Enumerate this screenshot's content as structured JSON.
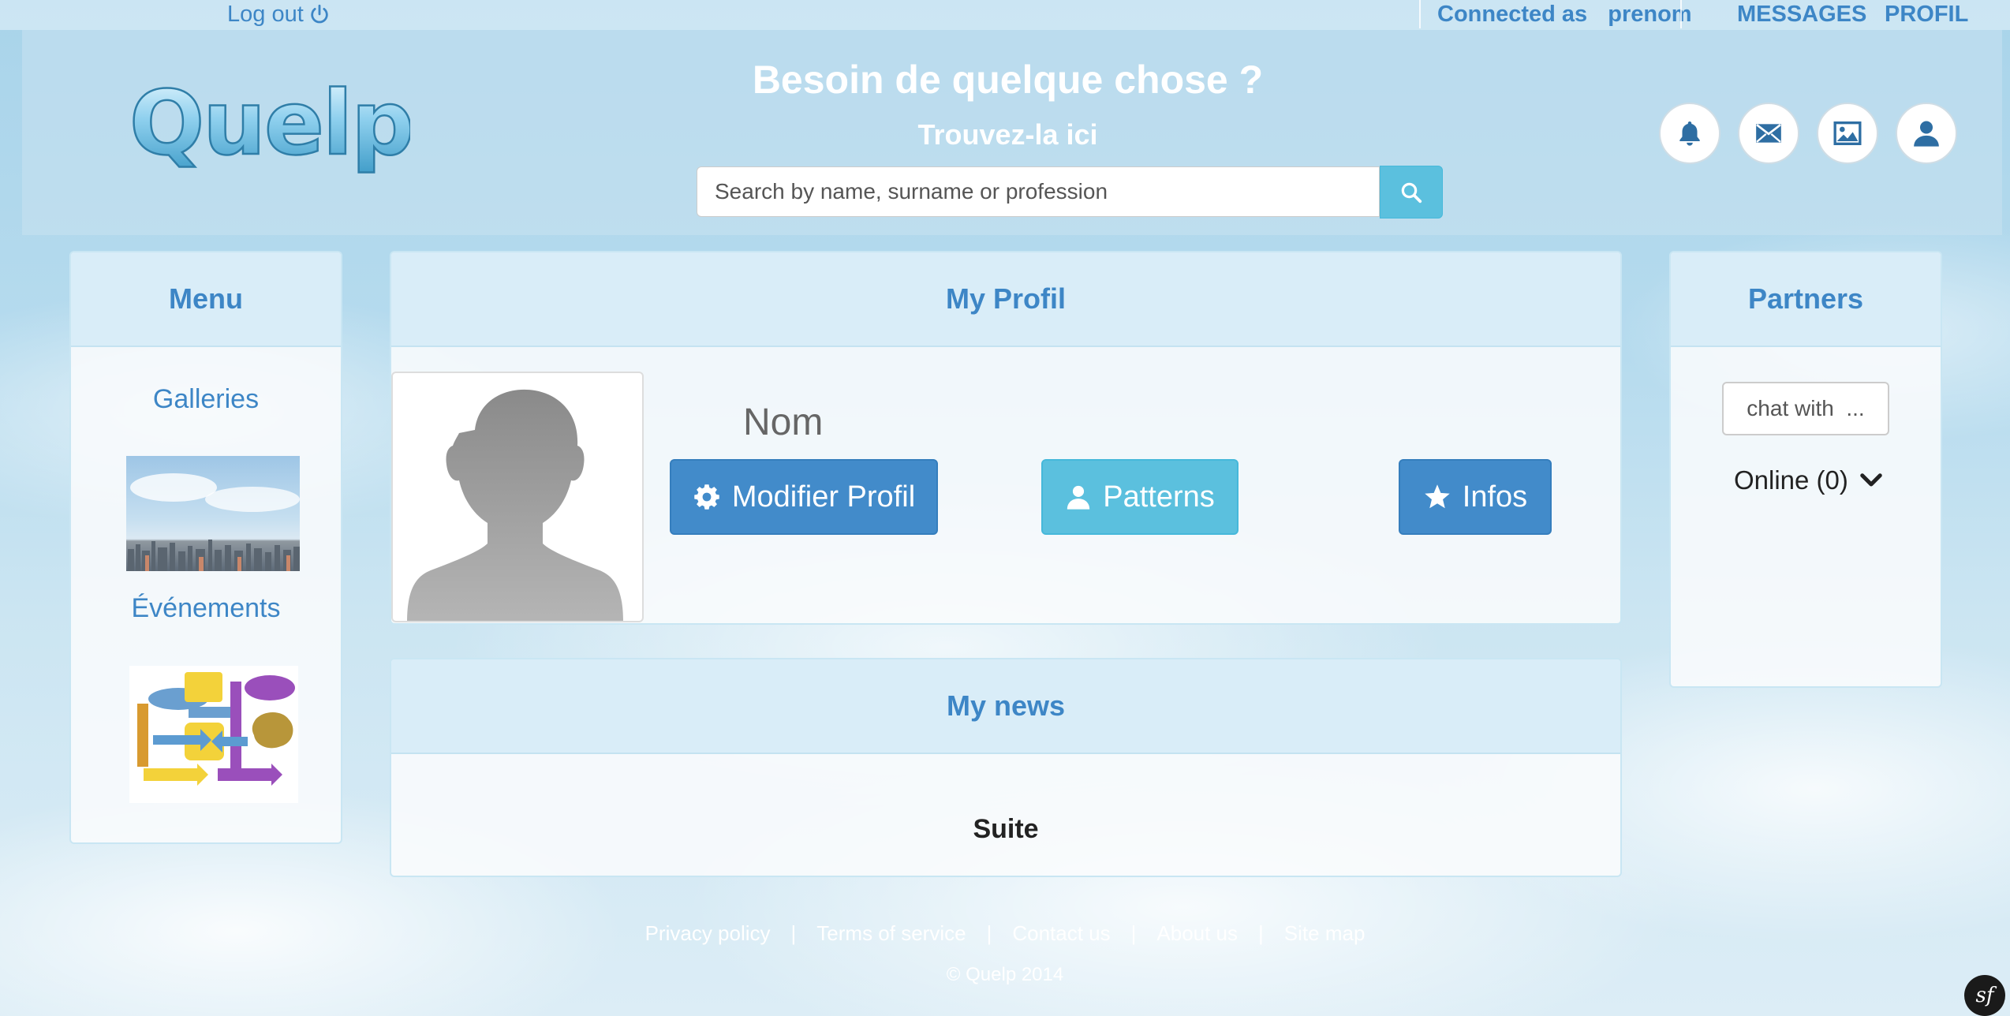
{
  "topbar": {
    "logout_label": "Log out",
    "connected_label": "Connected as",
    "username": "prenom",
    "messages_label": "MESSAGES",
    "profil_label": "PROFIL"
  },
  "header": {
    "logo_text": "Quelp",
    "headline": "Besoin de quelque chose ?",
    "subline": "Trouvez-la ici",
    "search_placeholder": "Search by name, surname or profession",
    "icons": [
      "bell-icon",
      "envelope-icon",
      "picture-icon",
      "user-icon"
    ]
  },
  "menu": {
    "title": "Menu",
    "items": [
      {
        "label": "Galleries"
      },
      {
        "label": "Événements"
      }
    ]
  },
  "profile": {
    "title": "My Profil",
    "name": "Nom",
    "buttons": [
      {
        "label": "Modifier Profil",
        "icon": "gear-icon"
      },
      {
        "label": "Patterns",
        "icon": "user-icon"
      },
      {
        "label": "Infos",
        "icon": "star-icon"
      }
    ]
  },
  "news": {
    "title": "My news",
    "link": "Suite"
  },
  "partners": {
    "title": "Partners",
    "chat_label": "chat with  ...",
    "online_label": "Online (0)"
  },
  "footer": {
    "links": [
      "Privacy policy",
      "Terms of service",
      "Contact us",
      "About us",
      "Site map"
    ],
    "copyright": "© Quelp 2014"
  },
  "colors": {
    "accent": "#3d86c6",
    "primary_button": "#428bca",
    "info_button": "#5bc0de"
  }
}
